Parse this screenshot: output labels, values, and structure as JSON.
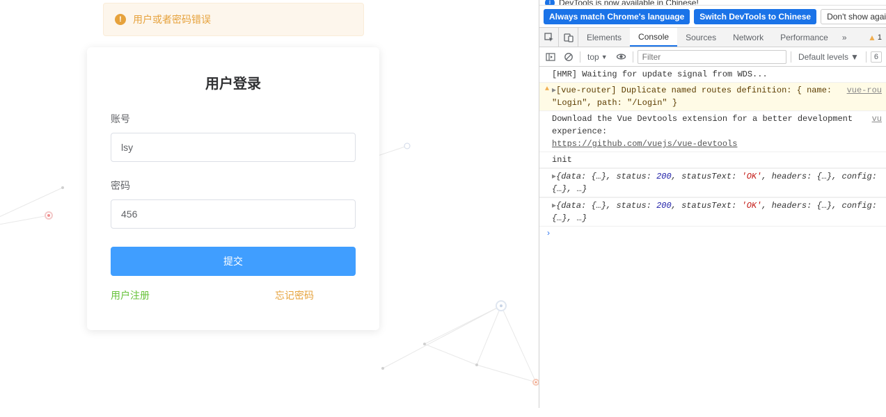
{
  "alert": {
    "text": "用户或者密码错误"
  },
  "login": {
    "title": "用户登录",
    "account_label": "账号",
    "account_value": "lsy",
    "password_label": "密码",
    "password_value": "456",
    "submit_label": "提交",
    "register_link": "用户注册",
    "forgot_link": "忘记密码"
  },
  "devtools": {
    "info_text": "DevTools is now available in Chinese!",
    "lang_match": "Always match Chrome's language",
    "lang_switch": "Switch DevTools to Chinese",
    "lang_dismiss": "Don't show again",
    "tabs": {
      "elements": "Elements",
      "console": "Console",
      "sources": "Sources",
      "network": "Network",
      "performance": "Performance"
    },
    "warn_count": "1",
    "toolbar": {
      "context": "top",
      "filter_placeholder": "Filter",
      "levels": "Default levels",
      "hidden": "6"
    },
    "logs": {
      "hmr": "[HMR] Waiting for update signal from WDS...",
      "router_warn": "[vue-router] Duplicate named routes definition: { name: \"Login\", path: \"/Login\" }",
      "router_src": "vue-rou",
      "devtools_msg1": "Download the Vue Devtools extension for a better development experience:",
      "devtools_link": "https://github.com/vuejs/vue-devtools",
      "devtools_src": "vu",
      "init": "init",
      "resp_prefix": "{data: {…}, status: ",
      "resp_status": "200",
      "resp_mid": ", statusText: ",
      "resp_ok": "'OK'",
      "resp_suffix": ", headers: {…}, config: {…}, …}"
    }
  }
}
